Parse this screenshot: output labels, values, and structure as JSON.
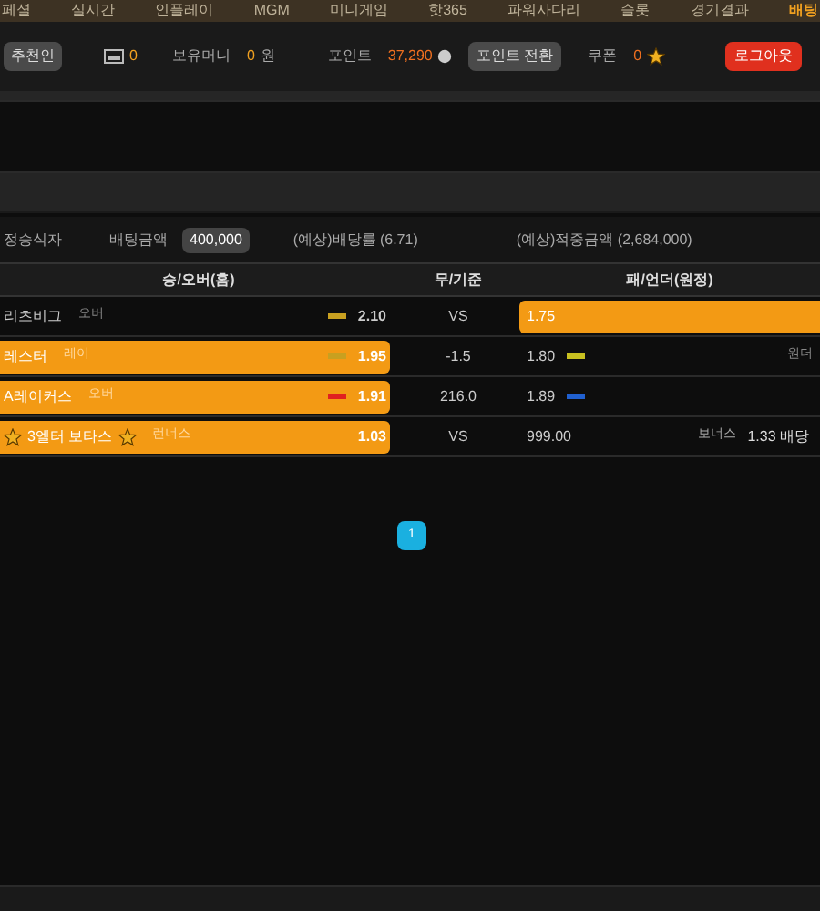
{
  "nav": {
    "items": [
      {
        "label": "페셜",
        "selected": false
      },
      {
        "label": "실시간",
        "selected": false
      },
      {
        "label": "인플레이",
        "selected": false
      },
      {
        "label": "MGM",
        "selected": false
      },
      {
        "label": "미니게임",
        "selected": false
      },
      {
        "label": "핫365",
        "selected": false
      },
      {
        "label": "파워사다리",
        "selected": false
      },
      {
        "label": "슬롯",
        "selected": false
      },
      {
        "label": "경기결과",
        "selected": false
      },
      {
        "label": "배팅",
        "selected": true
      }
    ]
  },
  "info_bar": {
    "referrer_button": "추천인",
    "messages": "0",
    "money_label": "보유머니",
    "money_value": "0",
    "money_unit": "원",
    "points_label": "포인트",
    "points_value": "37,290",
    "points_convert_button": "포인트 전환",
    "coupon_label": "쿠폰",
    "coupon_value": "0",
    "logout_button": "로그아웃"
  },
  "slip": {
    "label_1": "정승식자",
    "amount_label": "배팅금액",
    "amount_value": "400,000",
    "odds": "(예상)배당률 (6.71)",
    "payout": "(예상)적중금액 (2,684,000)"
  },
  "table": {
    "columns": [
      "승/오버(홈)",
      "무/기준",
      "패/언더(원정)"
    ],
    "rows": [
      {
        "home": "리츠비그",
        "home_tag": "오버",
        "home_odds": "2.10",
        "home_selected": false,
        "home_mark": {
          "color": "#c8a020"
        },
        "middle": "VS",
        "away_odds": "1.75",
        "away_selected": true,
        "starred": false
      },
      {
        "home": "레스터",
        "home_tag": "레이",
        "home_odds": "1.95",
        "home_selected": true,
        "home_mark": {
          "color": "#c8a020"
        },
        "middle": "-1.5",
        "away_odds": "1.80",
        "away_selected": false,
        "away_mark": {
          "color": "#c8c020"
        },
        "away_tag": "원더",
        "starred": false
      },
      {
        "home": "A레이커스",
        "home_tag": "오버",
        "home_odds": "1.91",
        "home_selected": true,
        "home_mark": {
          "color": "#e02020"
        },
        "middle": "216.0",
        "away_odds": "1.89",
        "away_selected": false,
        "away_mark": {
          "color": "#2060d0"
        },
        "starred": false
      },
      {
        "home": "3엘터 보타스",
        "home_tag": "런너스",
        "home_odds": "1.03",
        "home_selected": true,
        "middle": "VS",
        "away_odds": "999.00",
        "away_selected": false,
        "bonus_label": "보너스",
        "bonus_value": "1.33 배당",
        "starred": true
      }
    ]
  },
  "pagination": [
    {
      "label": "1",
      "selected": true
    }
  ]
}
